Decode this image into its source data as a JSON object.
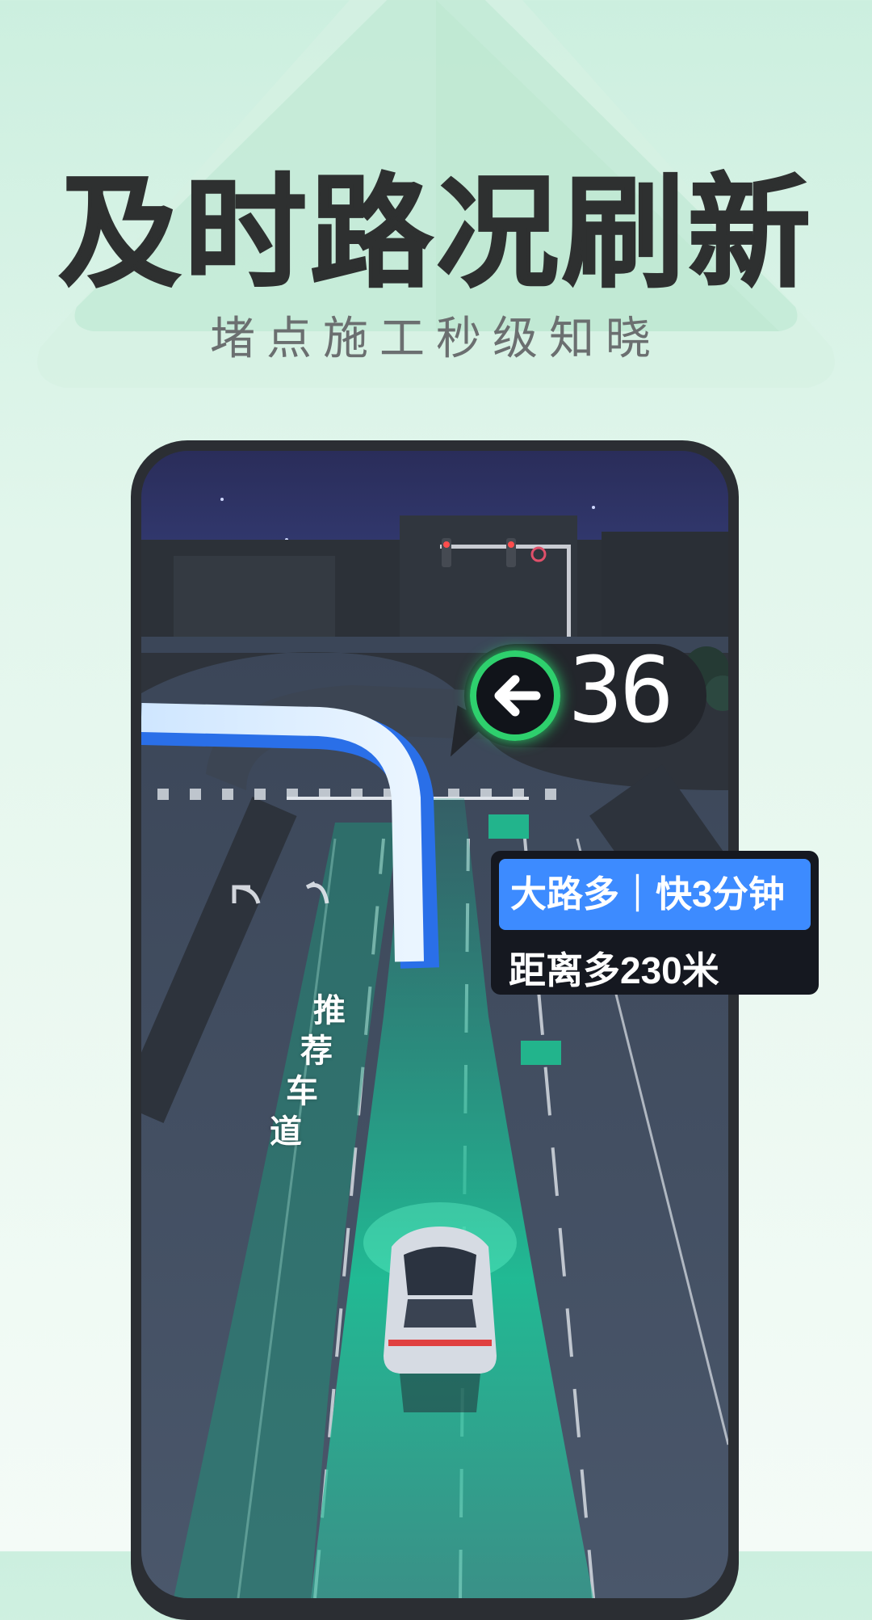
{
  "header": {
    "title": "及时路况刷新",
    "subtitle": "堵点施工秒级知晓"
  },
  "navigation": {
    "signal_countdown": "36",
    "signal_icon": "left-arrow-signal-icon",
    "route_tag": "大路多｜快3分钟",
    "route_distance": "距离多230米",
    "lane_label_chars": [
      "推",
      "荐",
      "车",
      "道"
    ]
  },
  "colors": {
    "background": "#d9f3e6",
    "title": "#2e3030",
    "phone_frame": "#2b2e33",
    "route_tag_blue": "#3d8bff",
    "signal_green": "#2ed06d",
    "recommended_lane": "#1fbf96"
  }
}
